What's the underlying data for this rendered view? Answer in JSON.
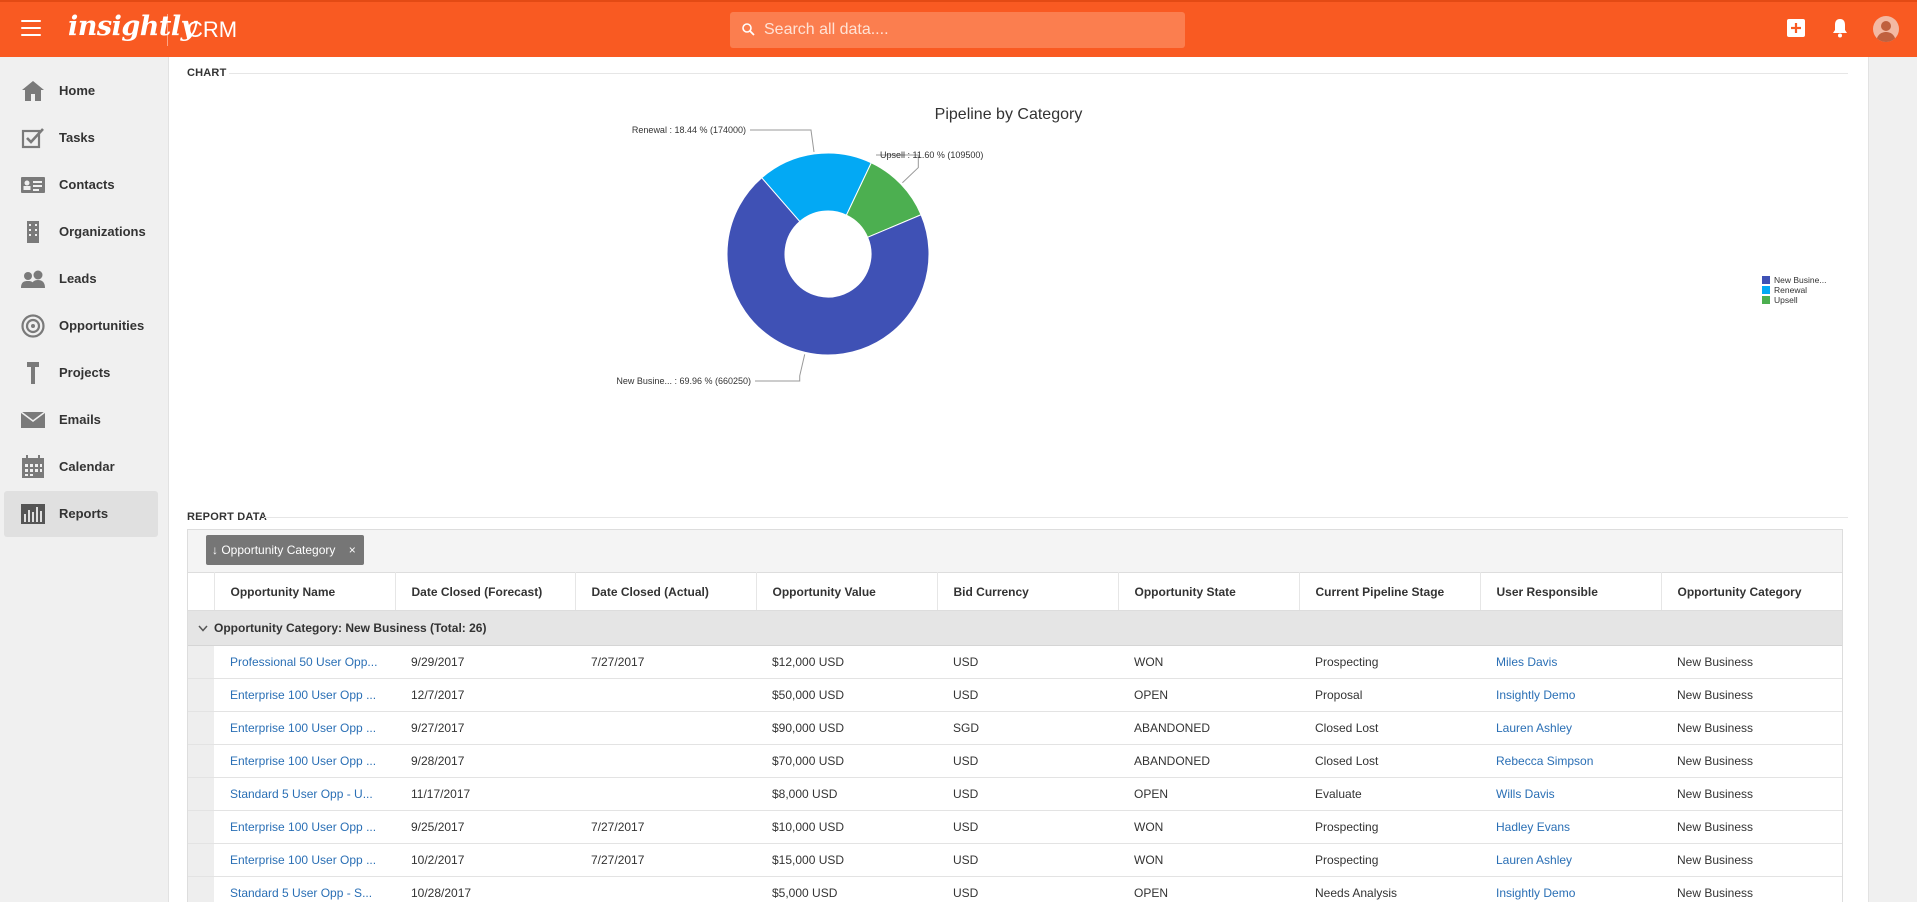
{
  "header": {
    "logo_text": "insightly",
    "app_name": "CRM",
    "search_placeholder": "Search all data....",
    "brand_color": "#f95a22"
  },
  "sidebar": {
    "items": [
      {
        "label": "Home",
        "icon": "home-icon"
      },
      {
        "label": "Tasks",
        "icon": "tasks-icon"
      },
      {
        "label": "Contacts",
        "icon": "contacts-icon"
      },
      {
        "label": "Organizations",
        "icon": "organizations-icon"
      },
      {
        "label": "Leads",
        "icon": "leads-icon"
      },
      {
        "label": "Opportunities",
        "icon": "opportunities-icon"
      },
      {
        "label": "Projects",
        "icon": "projects-icon"
      },
      {
        "label": "Emails",
        "icon": "emails-icon"
      },
      {
        "label": "Calendar",
        "icon": "calendar-icon"
      },
      {
        "label": "Reports",
        "icon": "reports-icon",
        "active": true
      }
    ]
  },
  "chart_section": {
    "label": "CHART"
  },
  "chart_data": {
    "type": "pie",
    "title": "Pipeline by Category",
    "donut": true,
    "legend_position": "right",
    "slices": [
      {
        "name": "New Busine...",
        "value": 660250,
        "percent": "69.96 %",
        "color": "#3f51b5"
      },
      {
        "name": "Renewal",
        "value": 174000,
        "percent": "18.44 %",
        "color": "#03a9f4"
      },
      {
        "name": "Upsell",
        "value": 109500,
        "percent": "11.60 %",
        "color": "#4caf50"
      }
    ],
    "labels": [
      "New Busine... : 69.96 % (660250)",
      "Renewal : 18.44 % (174000)",
      "Upsell : 11.60 % (109500)"
    ]
  },
  "report_section": {
    "label": "REPORT DATA"
  },
  "grouping": {
    "arrow": "↓",
    "label": "Opportunity Category",
    "close": "×"
  },
  "table": {
    "columns": [
      "Opportunity Name",
      "Date Closed (Forecast)",
      "Date Closed (Actual)",
      "Opportunity Value",
      "Bid Currency",
      "Opportunity State",
      "Current Pipeline Stage",
      "User Responsible",
      "Opportunity Category"
    ],
    "group_header": "Opportunity Category: New Business (Total: 26)",
    "rows": [
      [
        "Professional 50 User Opp...",
        "9/29/2017",
        "7/27/2017",
        "$12,000 USD",
        "USD",
        "WON",
        "Prospecting",
        "Miles Davis",
        "New Business"
      ],
      [
        "Enterprise 100 User Opp ...",
        "12/7/2017",
        "",
        "$50,000 USD",
        "USD",
        "OPEN",
        "Proposal",
        "Insightly Demo",
        "New Business"
      ],
      [
        "Enterprise 100 User Opp ...",
        "9/27/2017",
        "",
        "$90,000 USD",
        "SGD",
        "ABANDONED",
        "Closed Lost",
        "Lauren Ashley",
        "New Business"
      ],
      [
        "Enterprise 100 User Opp ...",
        "9/28/2017",
        "",
        "$70,000 USD",
        "USD",
        "ABANDONED",
        "Closed Lost",
        "Rebecca Simpson",
        "New Business"
      ],
      [
        "Standard 5 User Opp - U...",
        "11/17/2017",
        "",
        "$8,000 USD",
        "USD",
        "OPEN",
        "Evaluate",
        "Wills Davis",
        "New Business"
      ],
      [
        "Enterprise 100 User Opp ...",
        "9/25/2017",
        "7/27/2017",
        "$10,000 USD",
        "USD",
        "WON",
        "Prospecting",
        "Hadley Evans",
        "New Business"
      ],
      [
        "Enterprise 100 User Opp ...",
        "10/2/2017",
        "7/27/2017",
        "$15,000 USD",
        "USD",
        "WON",
        "Prospecting",
        "Lauren Ashley",
        "New Business"
      ],
      [
        "Standard 5 User Opp - S...",
        "10/28/2017",
        "",
        "$5,000 USD",
        "USD",
        "OPEN",
        "Needs Analysis",
        "Insightly Demo",
        "New Business"
      ]
    ]
  }
}
